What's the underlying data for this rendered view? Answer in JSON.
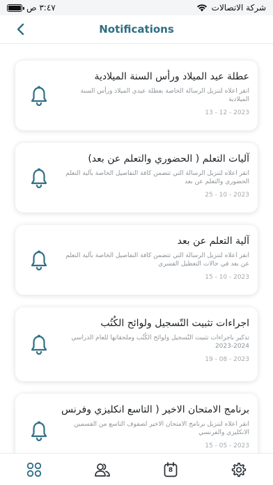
{
  "status_bar": {
    "time": "٣:٤٧ ص",
    "carrier": "شركة الاتصالات"
  },
  "header": {
    "title": "Notifications"
  },
  "notifications": [
    {
      "title": "عطلة عيد الميلاد ورأس السنة الميلادية",
      "description": "انقر اعلاه لتنزيل الرسالة الخاصة بعطلة عيدي الميلاد ورأس السنة الميلادية",
      "date": "13 - 12 - 2023"
    },
    {
      "title": "آليات التعلم ( الحضوري والتعلم عن بعد)",
      "description": "انقر اعلاه لتنزيل الرسالة التي تتضمن كافة التفاصيل الخاصة بآلية التعلم الحضوري والتعلم عن بعد",
      "date": "25 - 10 - 2023"
    },
    {
      "title": "آلية التعلم عن بعد",
      "description": "انقر اعلاه لتنزيل الرسالة التي تتضمن كافة التفاصيل الخاصة بآلية التعلم عن بعد في حالات التعطيل القسري",
      "date": "15 - 10 - 2023"
    },
    {
      "title": "اجراءات تثبيت التّسجيل ولوائح الكُتُب",
      "description": "تذكير باجراءات تثبيت التّسجيل ولوائح الكُتُب وملحقاتها للعام الدراسي 2024-2023",
      "date": "19 - 08 - 2023"
    },
    {
      "title": "برنامج الامتحان الاخير ( التاسع انكليزي وفرنس",
      "description": "انقر اعلاه لتنزيل برنامج الامتحان الاخير لصفوف التاسع من القسمين الانكليزي والفرنسي",
      "date": "15 - 05 - 2023"
    }
  ],
  "tab_bar": {
    "items": [
      "grid-icon",
      "users-icon",
      "calendar-icon",
      "gear-icon"
    ],
    "calendar_day": "8"
  },
  "colors": {
    "accent": "#2e6e83",
    "bell": "#2f6f86",
    "text": "#1d2124",
    "muted": "#8e9499"
  }
}
